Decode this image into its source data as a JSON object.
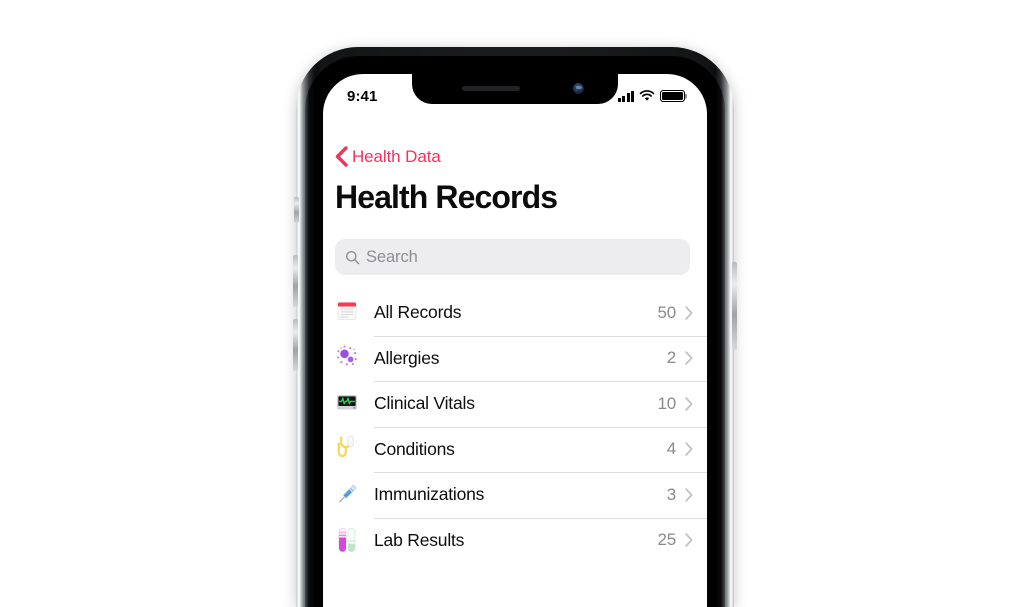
{
  "device": {
    "status_bar": {
      "time": "9:41",
      "signal_icon": "cellular-signal-icon",
      "wifi_icon": "wifi-icon",
      "battery_icon": "battery-full-icon"
    },
    "notch": {
      "speaker_icon": "earpiece-speaker-icon",
      "camera_icon": "front-camera-icon"
    },
    "buttons": {
      "mute_switch": "mute-switch",
      "volume_up": "volume-up-button",
      "volume_down": "volume-down-button",
      "power": "power-button"
    }
  },
  "nav": {
    "back_icon": "chevron-left-icon",
    "back_label": "Health Data",
    "accent_color": "#F6325A"
  },
  "header": {
    "title": "Health Records"
  },
  "search": {
    "icon": "search-icon",
    "placeholder": "Search",
    "value": ""
  },
  "list": {
    "chevron_icon": "chevron-right-icon",
    "rows": [
      {
        "icon": "document-records-icon",
        "label": "All Records",
        "count": "50"
      },
      {
        "icon": "allergen-particles-icon",
        "label": "Allergies",
        "count": "2"
      },
      {
        "icon": "vitals-monitor-icon",
        "label": "Clinical Vitals",
        "count": "10"
      },
      {
        "icon": "stethoscope-icon",
        "label": "Conditions",
        "count": "4"
      },
      {
        "icon": "syringe-icon",
        "label": "Immunizations",
        "count": "3"
      },
      {
        "icon": "test-tubes-icon",
        "label": "Lab Results",
        "count": "25"
      }
    ]
  },
  "colors": {
    "accent_pink": "#F6325A",
    "records_red": "#F63A52",
    "allergy_purple": "#9B4FE0",
    "vitals_green": "#2BD14A",
    "conditions_yellow": "#F5D64E",
    "immunization_blue": "#4A9BE8",
    "lab_magenta": "#D24BD8",
    "secondary_text": "#8A8A8E",
    "separator": "#DCDCDE",
    "search_bg": "#EDEDEF"
  }
}
